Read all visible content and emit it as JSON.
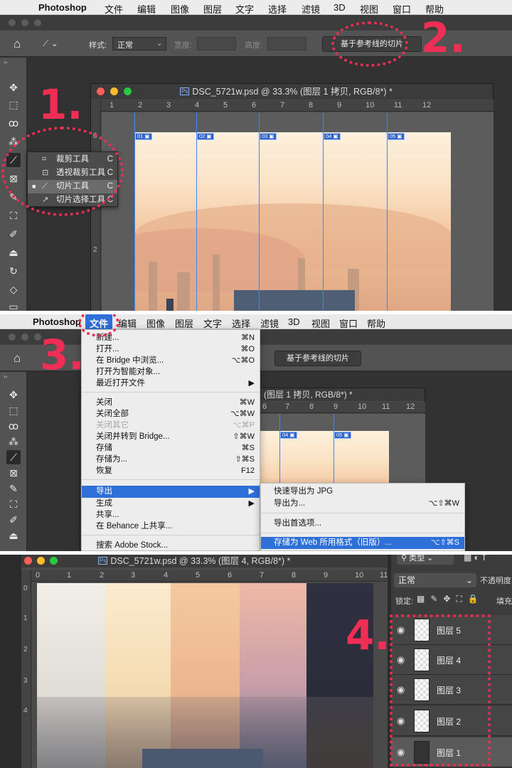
{
  "menubar1": {
    "apple": "",
    "app": "Photoshop",
    "items": [
      "文件",
      "编辑",
      "图像",
      "图层",
      "文字",
      "选择",
      "滤镜",
      "3D",
      "视图",
      "窗口",
      "帮助"
    ]
  },
  "menubar2": {
    "apple": "",
    "app": "Photoshop",
    "items": [
      "文件",
      "编辑",
      "图像",
      "图层",
      "文字",
      "选择",
      "滤镜",
      "3D",
      "视图",
      "窗口",
      "帮助"
    ]
  },
  "options": {
    "home": "⌂",
    "style_label": "样式:",
    "style_value": "正常",
    "width_label": "宽度:",
    "height_label": "高度:",
    "slices_button": "基于参考线的切片"
  },
  "doc1": {
    "title": "DSC_5721w.psd @ 33.3% (图层 1 拷贝, RGB/8*) *",
    "ruler": [
      "1",
      "2",
      "3",
      "4",
      "5",
      "6",
      "7",
      "8",
      "9",
      "10",
      "11",
      "12"
    ],
    "vruler": [
      "0",
      "1",
      "2"
    ],
    "slices": [
      "01",
      "02",
      "03",
      "04",
      "05"
    ]
  },
  "doc2": {
    "title": "(图层 1 拷贝, RGB/8*) *",
    "ruler": [
      "6",
      "7",
      "8",
      "9",
      "10",
      "11",
      "12"
    ],
    "vruler": [
      "1"
    ],
    "slices": [
      "04",
      "05"
    ]
  },
  "doc3": {
    "title": "DSC_5721w.psd @ 33.3% (图层 4, RGB/8*) *",
    "ruler": [
      "0",
      "1",
      "2",
      "3",
      "4",
      "5",
      "6",
      "7",
      "8",
      "9",
      "10",
      "11"
    ],
    "vruler": [
      "0",
      "1",
      "2",
      "3",
      "4"
    ]
  },
  "flyout": [
    {
      "icon": "⌗",
      "label": "裁剪工具",
      "shortcut": "C",
      "selected": false
    },
    {
      "icon": "⊡",
      "label": "透视裁剪工具",
      "shortcut": "C",
      "selected": false
    },
    {
      "icon": "⟋",
      "label": "切片工具",
      "shortcut": "C",
      "selected": true
    },
    {
      "icon": "↗",
      "label": "切片选择工具",
      "shortcut": "C",
      "selected": false
    }
  ],
  "file_menu": {
    "title": "文件",
    "items": [
      {
        "label": "新建...",
        "shortcut": "⌘N"
      },
      {
        "label": "打开...",
        "shortcut": "⌘O"
      },
      {
        "label": "在 Bridge 中浏览...",
        "shortcut": "⌥⌘O"
      },
      {
        "label": "打开为智能对象...",
        "shortcut": ""
      },
      {
        "label": "最近打开文件",
        "shortcut": "▶"
      },
      {
        "sep": true
      },
      {
        "label": "关闭",
        "shortcut": "⌘W"
      },
      {
        "label": "关闭全部",
        "shortcut": "⌥⌘W"
      },
      {
        "label": "关闭其它",
        "shortcut": "⌥⌘P",
        "disabled": true
      },
      {
        "label": "关闭并转到 Bridge...",
        "shortcut": "⇧⌘W"
      },
      {
        "label": "存储",
        "shortcut": "⌘S"
      },
      {
        "label": "存储为...",
        "shortcut": "⇧⌘S"
      },
      {
        "label": "恢复",
        "shortcut": "F12"
      },
      {
        "sep": true
      },
      {
        "label": "导出",
        "shortcut": "▶",
        "highlight": true
      },
      {
        "label": "生成",
        "shortcut": "▶"
      },
      {
        "label": "共享...",
        "shortcut": ""
      },
      {
        "label": "在 Behance 上共享...",
        "shortcut": ""
      },
      {
        "sep": true
      },
      {
        "label": "搜索 Adobe Stock...",
        "shortcut": ""
      }
    ]
  },
  "export_menu": {
    "items": [
      {
        "label": "快速导出为 JPG",
        "shortcut": ""
      },
      {
        "label": "导出为...",
        "shortcut": "⌥⇧⌘W"
      },
      {
        "sep": true
      },
      {
        "label": "导出首选项...",
        "shortcut": ""
      },
      {
        "sep": true
      },
      {
        "label": "存储为 Web 所用格式（旧版）...",
        "shortcut": "⌥⇧⌘S",
        "highlight": true
      }
    ]
  },
  "layers_panel": {
    "kind_label": "类型",
    "blend": "正常",
    "opacity_label": "不透明度",
    "lock_label": "锁定:",
    "fill_label": "填充",
    "layers": [
      "图层 5",
      "图层 4",
      "图层 3",
      "图层 2",
      "图层 1"
    ]
  },
  "steps": [
    "1.",
    "2.",
    "3.",
    "4."
  ],
  "colors": {
    "accent": "#ef2d55",
    "guide": "#3d84ff",
    "highlight": "#2f6fd8"
  }
}
